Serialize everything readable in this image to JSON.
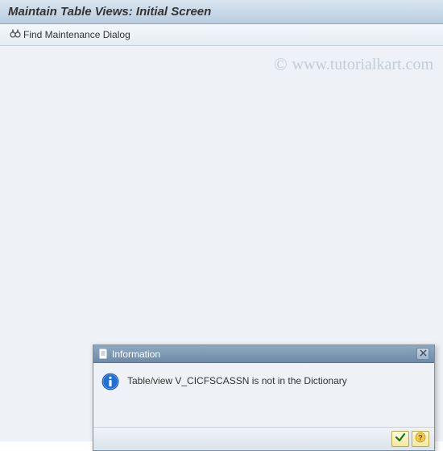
{
  "header": {
    "title": "Maintain Table Views: Initial Screen"
  },
  "toolbar": {
    "find_label": "Find Maintenance Dialog"
  },
  "watermark": {
    "symbol": "©",
    "text": "www.tutorialkart.com"
  },
  "dialog": {
    "title": "Information",
    "message": "Table/view V_CICFSCASSN is not in the Dictionary"
  }
}
